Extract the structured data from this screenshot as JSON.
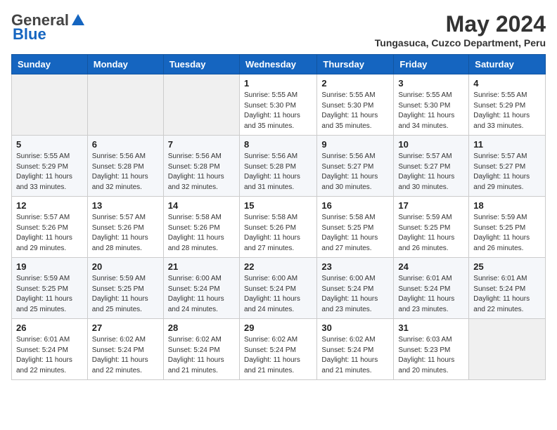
{
  "header": {
    "logo_general": "General",
    "logo_blue": "Blue",
    "month": "May 2024",
    "location": "Tungasuca, Cuzco Department, Peru"
  },
  "weekdays": [
    "Sunday",
    "Monday",
    "Tuesday",
    "Wednesday",
    "Thursday",
    "Friday",
    "Saturday"
  ],
  "weeks": [
    [
      {
        "day": "",
        "info": ""
      },
      {
        "day": "",
        "info": ""
      },
      {
        "day": "",
        "info": ""
      },
      {
        "day": "1",
        "info": "Sunrise: 5:55 AM\nSunset: 5:30 PM\nDaylight: 11 hours\nand 35 minutes."
      },
      {
        "day": "2",
        "info": "Sunrise: 5:55 AM\nSunset: 5:30 PM\nDaylight: 11 hours\nand 35 minutes."
      },
      {
        "day": "3",
        "info": "Sunrise: 5:55 AM\nSunset: 5:30 PM\nDaylight: 11 hours\nand 34 minutes."
      },
      {
        "day": "4",
        "info": "Sunrise: 5:55 AM\nSunset: 5:29 PM\nDaylight: 11 hours\nand 33 minutes."
      }
    ],
    [
      {
        "day": "5",
        "info": "Sunrise: 5:55 AM\nSunset: 5:29 PM\nDaylight: 11 hours\nand 33 minutes."
      },
      {
        "day": "6",
        "info": "Sunrise: 5:56 AM\nSunset: 5:28 PM\nDaylight: 11 hours\nand 32 minutes."
      },
      {
        "day": "7",
        "info": "Sunrise: 5:56 AM\nSunset: 5:28 PM\nDaylight: 11 hours\nand 32 minutes."
      },
      {
        "day": "8",
        "info": "Sunrise: 5:56 AM\nSunset: 5:28 PM\nDaylight: 11 hours\nand 31 minutes."
      },
      {
        "day": "9",
        "info": "Sunrise: 5:56 AM\nSunset: 5:27 PM\nDaylight: 11 hours\nand 30 minutes."
      },
      {
        "day": "10",
        "info": "Sunrise: 5:57 AM\nSunset: 5:27 PM\nDaylight: 11 hours\nand 30 minutes."
      },
      {
        "day": "11",
        "info": "Sunrise: 5:57 AM\nSunset: 5:27 PM\nDaylight: 11 hours\nand 29 minutes."
      }
    ],
    [
      {
        "day": "12",
        "info": "Sunrise: 5:57 AM\nSunset: 5:26 PM\nDaylight: 11 hours\nand 29 minutes."
      },
      {
        "day": "13",
        "info": "Sunrise: 5:57 AM\nSunset: 5:26 PM\nDaylight: 11 hours\nand 28 minutes."
      },
      {
        "day": "14",
        "info": "Sunrise: 5:58 AM\nSunset: 5:26 PM\nDaylight: 11 hours\nand 28 minutes."
      },
      {
        "day": "15",
        "info": "Sunrise: 5:58 AM\nSunset: 5:26 PM\nDaylight: 11 hours\nand 27 minutes."
      },
      {
        "day": "16",
        "info": "Sunrise: 5:58 AM\nSunset: 5:25 PM\nDaylight: 11 hours\nand 27 minutes."
      },
      {
        "day": "17",
        "info": "Sunrise: 5:59 AM\nSunset: 5:25 PM\nDaylight: 11 hours\nand 26 minutes."
      },
      {
        "day": "18",
        "info": "Sunrise: 5:59 AM\nSunset: 5:25 PM\nDaylight: 11 hours\nand 26 minutes."
      }
    ],
    [
      {
        "day": "19",
        "info": "Sunrise: 5:59 AM\nSunset: 5:25 PM\nDaylight: 11 hours\nand 25 minutes."
      },
      {
        "day": "20",
        "info": "Sunrise: 5:59 AM\nSunset: 5:25 PM\nDaylight: 11 hours\nand 25 minutes."
      },
      {
        "day": "21",
        "info": "Sunrise: 6:00 AM\nSunset: 5:24 PM\nDaylight: 11 hours\nand 24 minutes."
      },
      {
        "day": "22",
        "info": "Sunrise: 6:00 AM\nSunset: 5:24 PM\nDaylight: 11 hours\nand 24 minutes."
      },
      {
        "day": "23",
        "info": "Sunrise: 6:00 AM\nSunset: 5:24 PM\nDaylight: 11 hours\nand 23 minutes."
      },
      {
        "day": "24",
        "info": "Sunrise: 6:01 AM\nSunset: 5:24 PM\nDaylight: 11 hours\nand 23 minutes."
      },
      {
        "day": "25",
        "info": "Sunrise: 6:01 AM\nSunset: 5:24 PM\nDaylight: 11 hours\nand 22 minutes."
      }
    ],
    [
      {
        "day": "26",
        "info": "Sunrise: 6:01 AM\nSunset: 5:24 PM\nDaylight: 11 hours\nand 22 minutes."
      },
      {
        "day": "27",
        "info": "Sunrise: 6:02 AM\nSunset: 5:24 PM\nDaylight: 11 hours\nand 22 minutes."
      },
      {
        "day": "28",
        "info": "Sunrise: 6:02 AM\nSunset: 5:24 PM\nDaylight: 11 hours\nand 21 minutes."
      },
      {
        "day": "29",
        "info": "Sunrise: 6:02 AM\nSunset: 5:24 PM\nDaylight: 11 hours\nand 21 minutes."
      },
      {
        "day": "30",
        "info": "Sunrise: 6:02 AM\nSunset: 5:24 PM\nDaylight: 11 hours\nand 21 minutes."
      },
      {
        "day": "31",
        "info": "Sunrise: 6:03 AM\nSunset: 5:23 PM\nDaylight: 11 hours\nand 20 minutes."
      },
      {
        "day": "",
        "info": ""
      }
    ]
  ]
}
